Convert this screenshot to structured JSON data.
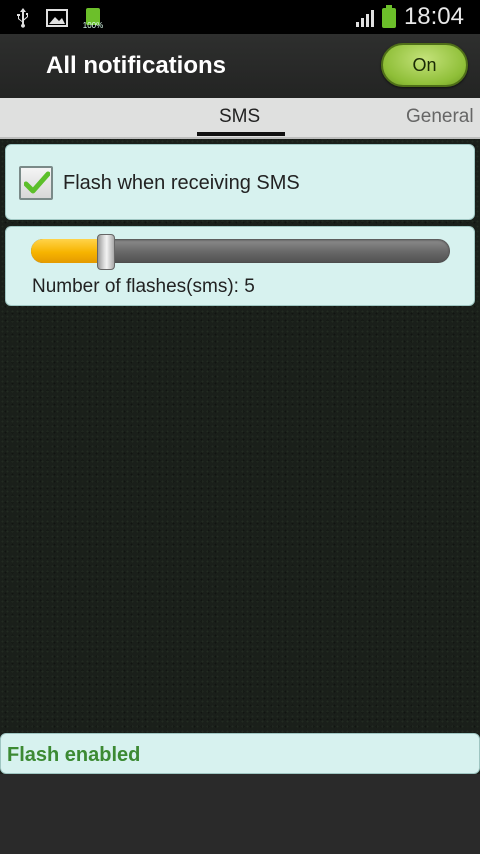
{
  "status_bar": {
    "time": "18:04",
    "battery_small_label": "100%",
    "icons": [
      "usb-icon",
      "image-icon",
      "battery-full-icon",
      "signal-icon",
      "battery-icon"
    ],
    "accent_green": "#6cbf2a"
  },
  "header": {
    "title": "All notifications",
    "toggle_label": "On"
  },
  "tabs": [
    {
      "label": "SMS",
      "selected": true
    },
    {
      "label": "General",
      "selected": false
    }
  ],
  "settings": {
    "flash_checkbox": {
      "label": "Flash when receiving SMS",
      "checked": true
    },
    "flash_count": {
      "label": "Number of flashes(sms): 5",
      "fraction": 0.18
    }
  },
  "status": {
    "text": "Flash enabled",
    "color": "#3c8a33"
  }
}
